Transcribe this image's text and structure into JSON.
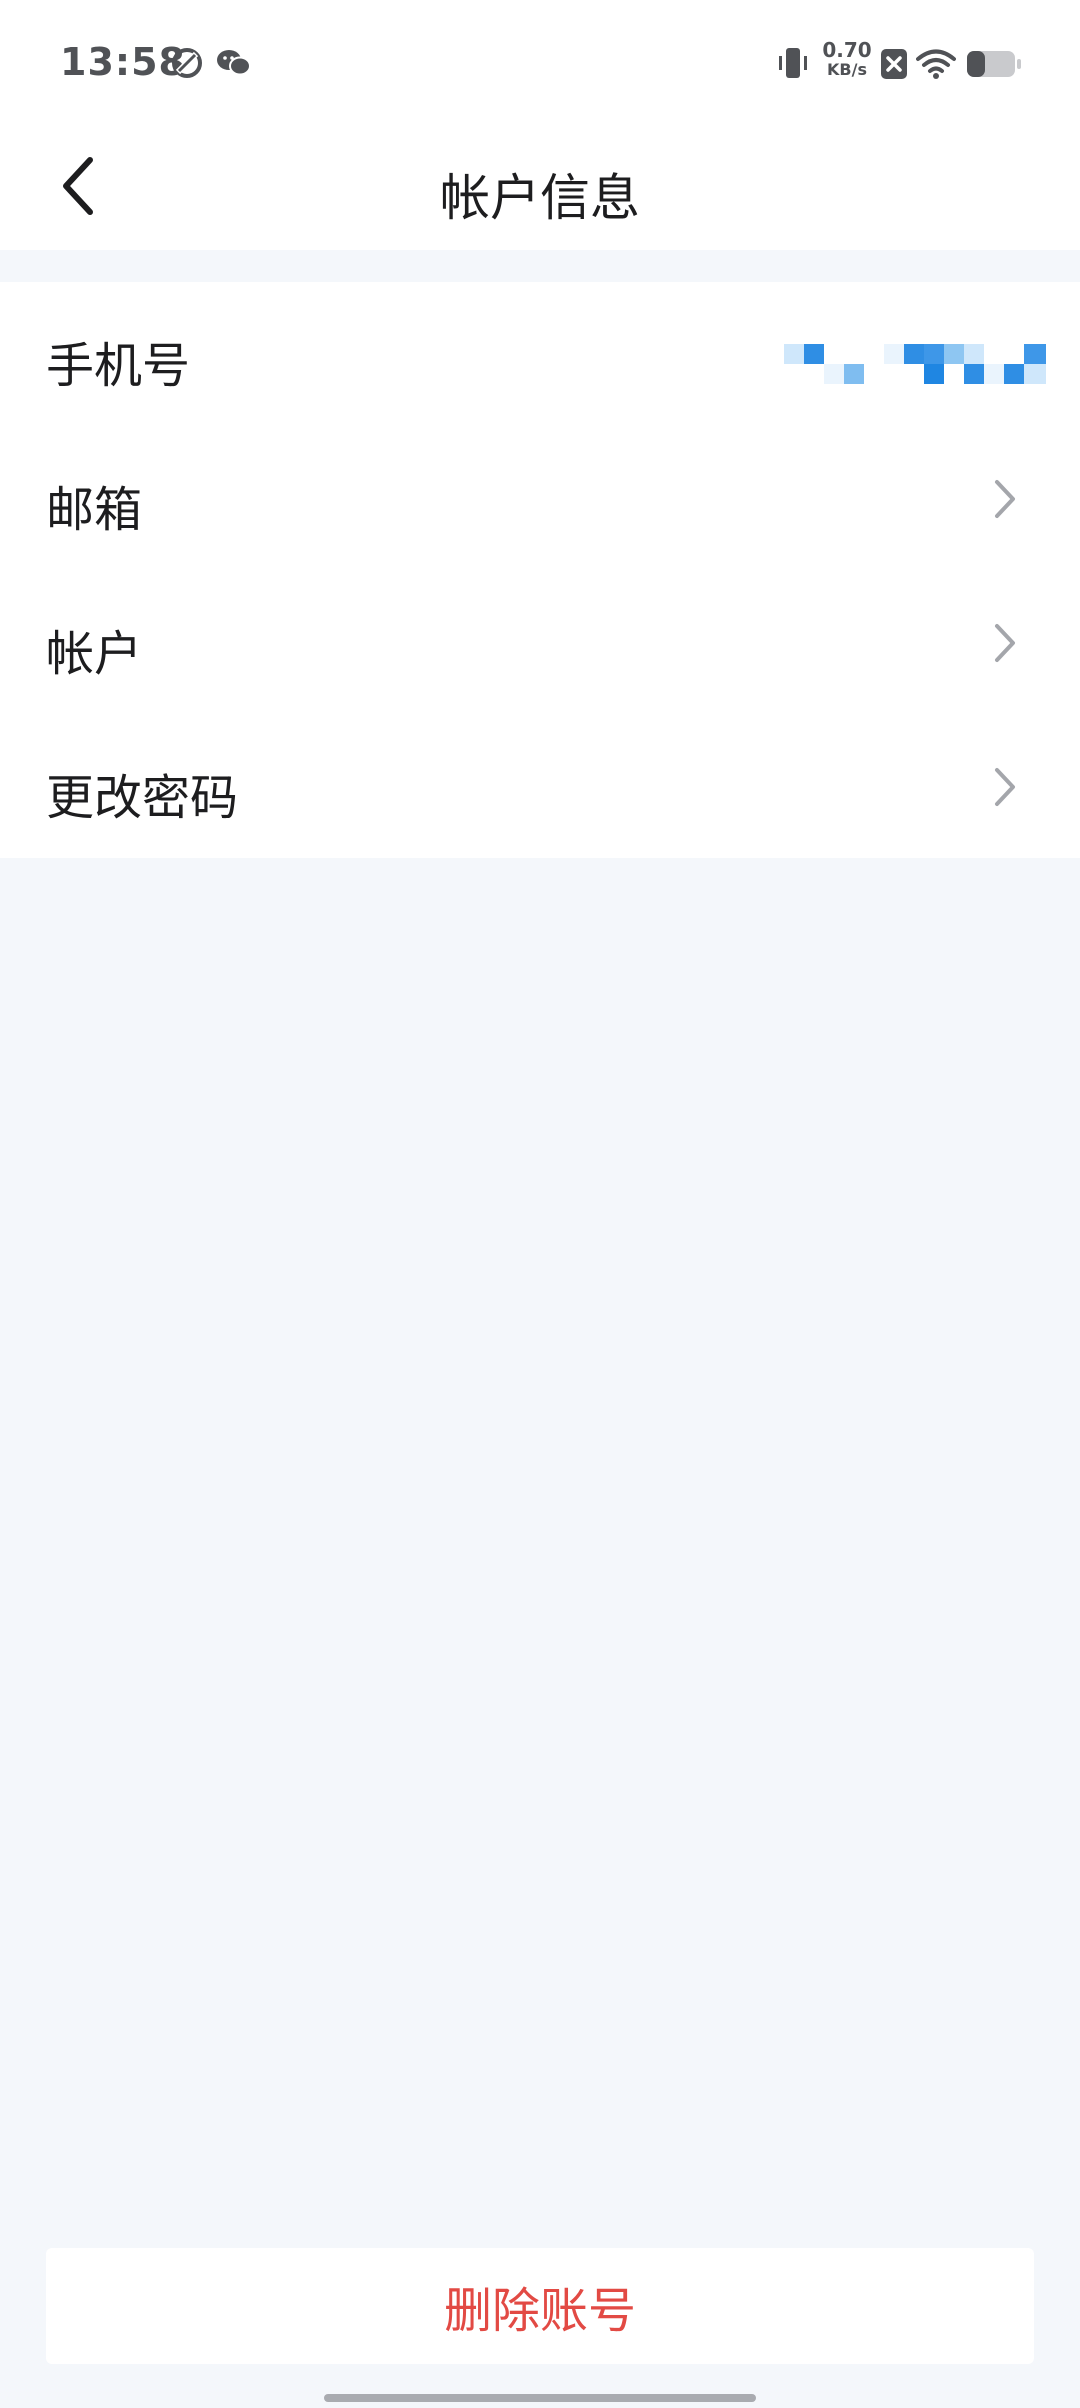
{
  "status_bar": {
    "time": "13:58",
    "net_speed_value": "0.70",
    "net_speed_unit": "KB/s",
    "icons": [
      "sync-icon",
      "wechat-icon",
      "vibrate-icon",
      "no-sim-icon",
      "wifi-icon",
      "battery-icon"
    ]
  },
  "nav": {
    "back_icon": "chevron-left-icon",
    "title": "帐户信息"
  },
  "list": {
    "items": [
      {
        "label": "手机号",
        "value_state": "pixelated"
      },
      {
        "label": "邮箱",
        "icon": "chevron-right-icon"
      },
      {
        "label": "帐户",
        "icon": "chevron-right-icon"
      },
      {
        "label": "更改密码",
        "icon": "chevron-right-icon"
      }
    ]
  },
  "footer": {
    "delete_label": "删除账号"
  },
  "colors": {
    "background": "#f4f7fb",
    "card": "#ffffff",
    "text": "#1d1d1f",
    "danger": "#e24a44",
    "chevron": "#a4a6ab"
  }
}
